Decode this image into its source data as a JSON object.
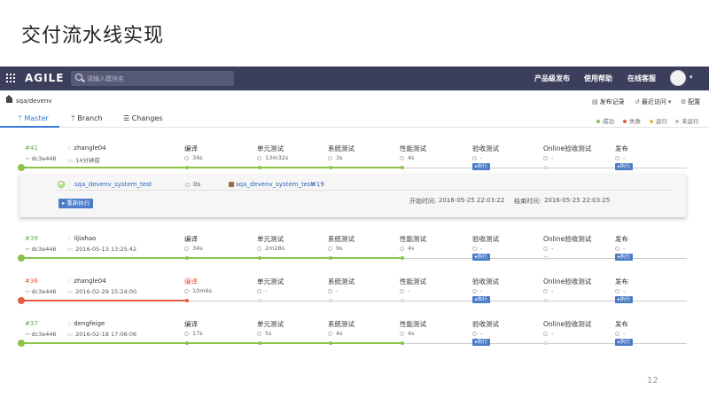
{
  "slide": {
    "title": "交付流水线实现",
    "page_number": "12"
  },
  "topbar": {
    "logo": "AGILE",
    "search_placeholder": "请输入模块名",
    "nav": [
      "产品级发布",
      "使用帮助",
      "在线客服"
    ],
    "background": "#3b3f5c"
  },
  "breadcrumb": "sqa/devenv",
  "toolbar": {
    "publish_log": "发布记录",
    "recent": "最近访问",
    "config": "配置"
  },
  "tabs": [
    {
      "label": "Master",
      "icon": "branch-icon",
      "active": true
    },
    {
      "label": "Branch",
      "icon": "branch-icon",
      "active": false
    },
    {
      "label": "Changes",
      "icon": "list-icon",
      "active": false
    }
  ],
  "legend": [
    {
      "label": "成功",
      "color": "#8bc34a"
    },
    {
      "label": "失败",
      "color": "#e55b3b"
    },
    {
      "label": "运行",
      "color": "#f0ad4e"
    },
    {
      "label": "未运行",
      "color": "#bbbbbb"
    }
  ],
  "stage_names": [
    "编译",
    "单元测试",
    "系统测试",
    "性能测试",
    "验收测试",
    "Online验收测试",
    "发布"
  ],
  "run_button": "执行",
  "pipelines": [
    {
      "id": "#41",
      "commit": "dc3e446",
      "user": "zhangle04",
      "time": "14分钟前",
      "status": "success",
      "stages": [
        {
          "duration": "34s",
          "state": "success"
        },
        {
          "duration": "13m32s",
          "state": "success"
        },
        {
          "duration": "3s",
          "state": "success"
        },
        {
          "duration": "4s",
          "state": "success"
        },
        {
          "duration": "-",
          "state": "pending"
        },
        {
          "duration": "-",
          "state": "pending"
        },
        {
          "duration": "-",
          "state": "pending"
        }
      ]
    },
    {
      "id": "#39",
      "commit": "dc3e446",
      "user": "lijiahao",
      "time": "2016-05-13 13:25:42",
      "status": "success",
      "stages": [
        {
          "duration": "34s",
          "state": "success"
        },
        {
          "duration": "2m28s",
          "state": "success"
        },
        {
          "duration": "9s",
          "state": "success"
        },
        {
          "duration": "4s",
          "state": "success"
        },
        {
          "duration": "-",
          "state": "pending"
        },
        {
          "duration": "-",
          "state": "pending"
        },
        {
          "duration": "-",
          "state": "pending"
        }
      ]
    },
    {
      "id": "#38",
      "commit": "dc3e446",
      "user": "zhangle04",
      "time": "2016-02-29 15:24:00",
      "status": "failed",
      "stages": [
        {
          "duration": "10m6s",
          "state": "failed"
        },
        {
          "duration": "-",
          "state": "pending"
        },
        {
          "duration": "-",
          "state": "pending"
        },
        {
          "duration": "-",
          "state": "pending"
        },
        {
          "duration": "-",
          "state": "pending"
        },
        {
          "duration": "-",
          "state": "pending"
        },
        {
          "duration": "-",
          "state": "pending"
        }
      ]
    },
    {
      "id": "#37",
      "commit": "dc3e446",
      "user": "dengfeige",
      "time": "2016-02-18 17:06:06",
      "status": "success",
      "stages": [
        {
          "duration": "17s",
          "state": "success"
        },
        {
          "duration": "5s",
          "state": "success"
        },
        {
          "duration": "4s",
          "state": "success"
        },
        {
          "duration": "4s",
          "state": "success"
        },
        {
          "duration": "-",
          "state": "pending"
        },
        {
          "duration": "-",
          "state": "pending"
        },
        {
          "duration": "-",
          "state": "pending"
        }
      ]
    }
  ],
  "detail": {
    "job": "sqa_devenv_system_test",
    "duration": "0s",
    "linked_job": "sqa_devenv_system_test",
    "linked_build": "#19",
    "start_label": "开始时间:",
    "start_time": "2016-05-25 22:03:22",
    "end_label": "结束时间:",
    "end_time": "2016-05-25 22:03:25",
    "rerun": "重新执行"
  }
}
